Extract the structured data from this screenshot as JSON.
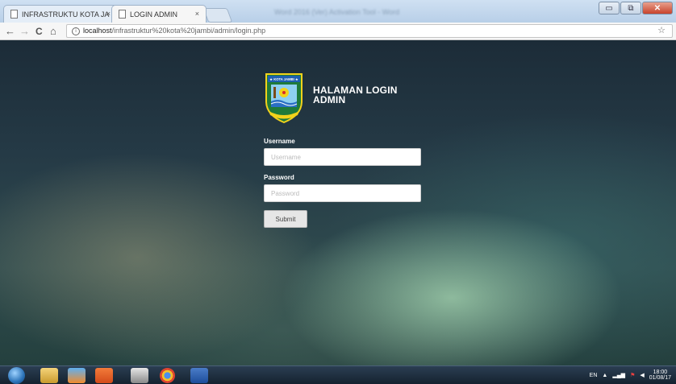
{
  "browser": {
    "tabs": [
      {
        "label": "INFRASTRUKTU KOTA JA",
        "close": "×"
      },
      {
        "label": "LOGIN ADMIN",
        "close": "×"
      }
    ],
    "blurred_window_title": "Word 2016 (Ver) Activation Tool - Word",
    "url_host": "localhost",
    "url_path": "/infrastruktur%20kota%20jambi/admin/login.php",
    "controls": {
      "back": "←",
      "forward": "→",
      "reload": "C",
      "home": "⌂",
      "bookmark": "☆"
    },
    "window_buttons": {
      "minimize": "▭",
      "restore": "⧉",
      "close": "✕"
    }
  },
  "login": {
    "logo_banner_text": "★ KOTA JAMBI ★",
    "title_line1": "HALAMAN LOGIN",
    "title_line2": "ADMIN",
    "username_label": "Username",
    "username_placeholder": "Username",
    "username_value": "",
    "password_label": "Password",
    "password_placeholder": "Password",
    "password_value": "",
    "submit_label": "Submit"
  },
  "taskbar": {
    "language": "EN",
    "tray_arrow": "▲",
    "time": "18:00",
    "date": "01/08/17",
    "apps": [
      "internet-explorer",
      "file-explorer",
      "xampp",
      "xampp-control",
      "bootstrap-editor",
      "chrome",
      "word"
    ]
  },
  "colors": {
    "page_bg": "#253a46",
    "heading": "#ffffff",
    "close_button": "#c8432b",
    "taskbar": "#1a2a38"
  }
}
